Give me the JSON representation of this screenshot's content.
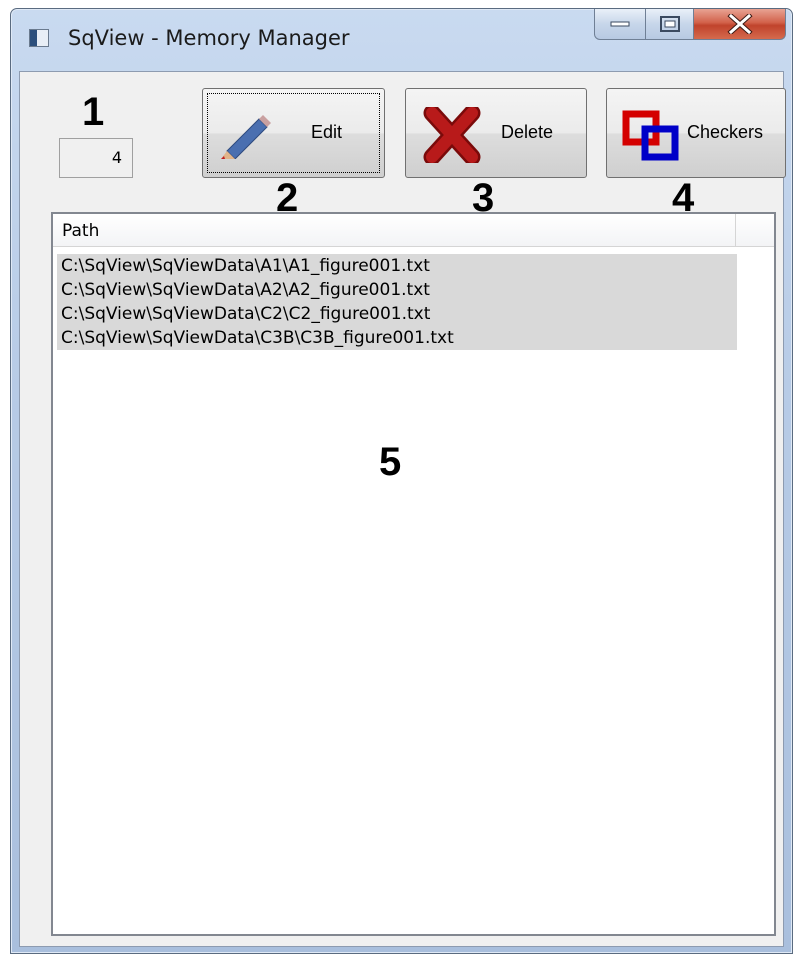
{
  "window": {
    "title": "SqView - Memory Manager"
  },
  "callouts": {
    "c1": "1",
    "c2": "2",
    "c3": "3",
    "c4": "4",
    "c5": "5"
  },
  "toolbar": {
    "count_value": "4",
    "edit_label": "Edit",
    "delete_label": "Delete",
    "checkers_label": "Checkers"
  },
  "list": {
    "column_header": "Path",
    "rows": [
      "C:\\SqView\\SqViewData\\A1\\A1_figure001.txt",
      "C:\\SqView\\SqViewData\\A2\\A2_figure001.txt",
      "C:\\SqView\\SqViewData\\C2\\C2_figure001.txt",
      "C:\\SqView\\SqViewData\\C3B\\C3B_figure001.txt"
    ]
  },
  "icons": {
    "app": "app-window-icon",
    "minimize": "minimize-icon",
    "maximize": "maximize-icon",
    "close": "close-x-icon",
    "edit": "pencil-icon",
    "delete": "red-x-icon",
    "checkers": "interlocked-squares-icon"
  },
  "colors": {
    "close_button": "#c7452f",
    "delete_icon": "#a01010",
    "checkers_red": "#d40000",
    "checkers_blue": "#0000c8",
    "pencil": "#4a6fb0",
    "row_highlight": "#d9d9d9"
  }
}
